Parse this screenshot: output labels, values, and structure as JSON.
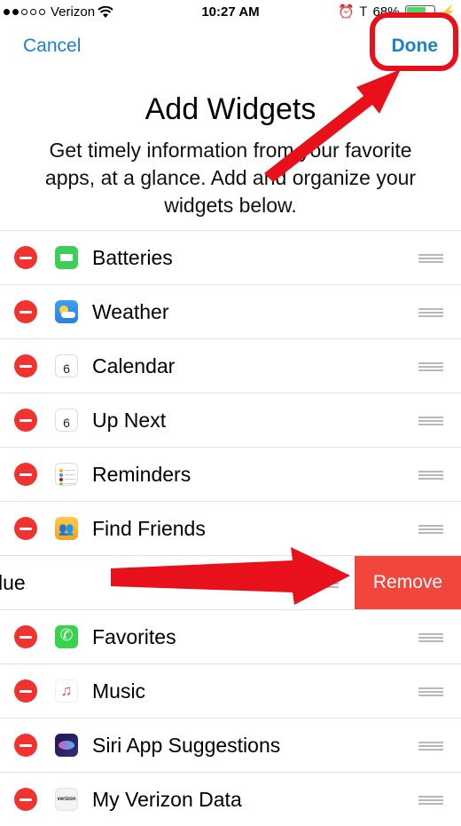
{
  "status_bar": {
    "carrier": "Verizon",
    "time": "10:27 AM",
    "battery": "68%"
  },
  "nav": {
    "cancel_label": "Cancel",
    "done_label": "Done"
  },
  "header": {
    "title": "Add Widgets",
    "subtitle": "Get timely information from your favorite apps, at a glance. Add and organize your widgets below."
  },
  "widgets": [
    {
      "label": "Batteries",
      "icon": "batteries-icon"
    },
    {
      "label": "Weather",
      "icon": "weather-icon"
    },
    {
      "label": "Calendar",
      "icon": "calendar-icon",
      "day": "6"
    },
    {
      "label": "Up Next",
      "icon": "calendar-icon",
      "day": "6"
    },
    {
      "label": "Reminders",
      "icon": "reminders-icon"
    },
    {
      "label": "Find Friends",
      "icon": "find-friends-icon"
    },
    {
      "label": "lue",
      "icon": "",
      "swiped": true
    },
    {
      "label": "Favorites",
      "icon": "phone-icon"
    },
    {
      "label": "Music",
      "icon": "music-icon"
    },
    {
      "label": "Siri App Suggestions",
      "icon": "siri-icon"
    },
    {
      "label": "My Verizon Data",
      "icon": "verizon-icon",
      "icon_text": "verizon"
    }
  ],
  "swipe_action": {
    "remove_label": "Remove"
  },
  "colors": {
    "accent": "#1a82c8",
    "destructive": "#f0332f",
    "annotation": "#e8101a"
  }
}
